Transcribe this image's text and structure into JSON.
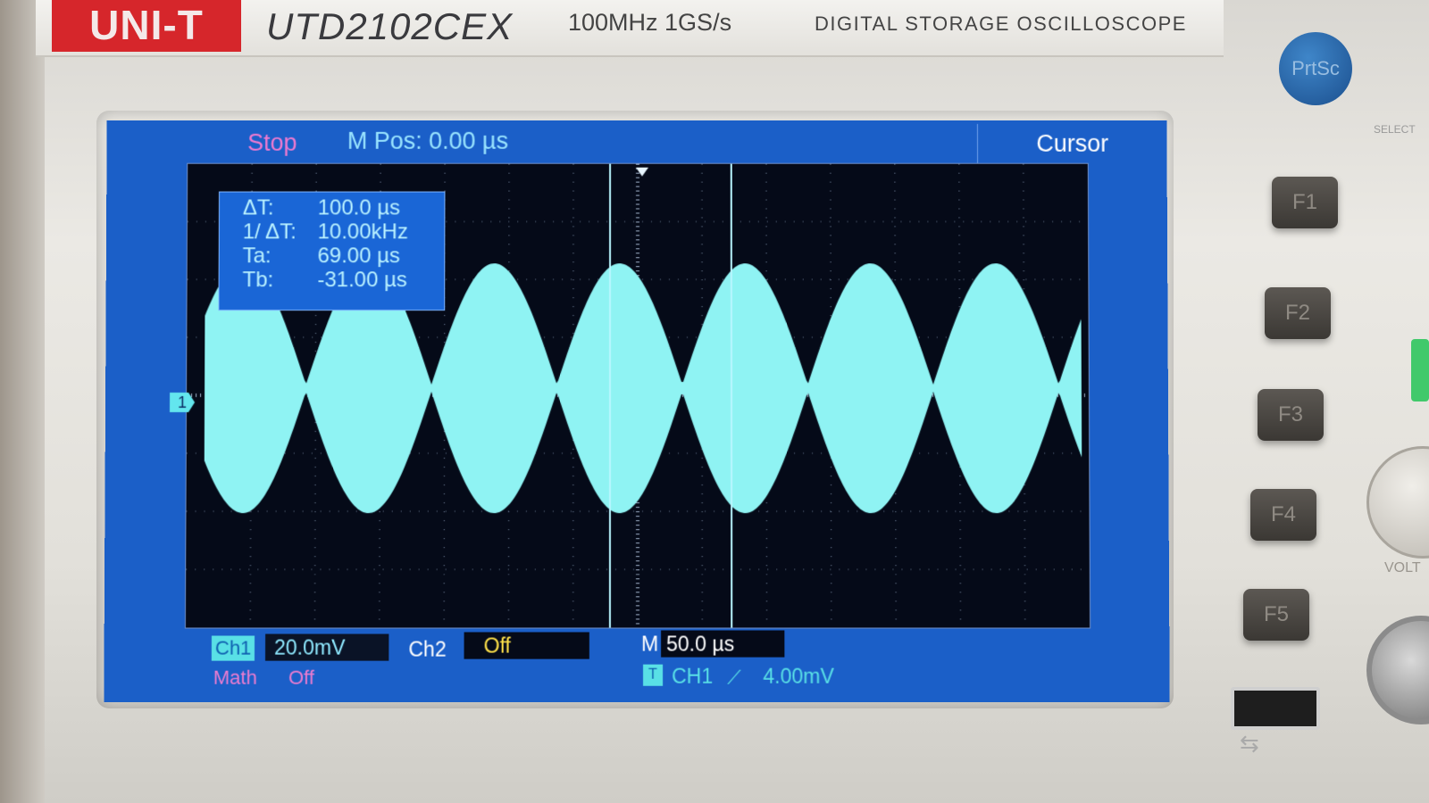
{
  "device": {
    "brand": "UNI-T",
    "model": "UTD2102CEX",
    "spec": "100MHz  1GS/s",
    "description": "DIGITAL STORAGE OSCILLOSCOPE"
  },
  "screen": {
    "run_state": "Stop",
    "m_pos": "M Pos: 0.00 µs",
    "menu_title": "Cursor",
    "cursor_readout": {
      "dt_label": "ΔT:",
      "dt_value": "100.0 µs",
      "inv_dt_label": "1/ ΔT:",
      "inv_dt_value": "10.00kHz",
      "ta_label": "Ta:",
      "ta_value": "69.00 µs",
      "tb_label": "Tb:",
      "tb_value": "-31.00 µs"
    },
    "channel_marker": "1",
    "bottom": {
      "ch1_tag": "Ch1",
      "ch1_scale": "20.0mV",
      "ch2_tag": "Ch2",
      "ch2_scale": "Off",
      "m_tag": "M",
      "m_scale": "50.0 µs",
      "math_label": "Math",
      "math_state": "Off",
      "trig_icon": "T",
      "trig_source": "CH1",
      "trig_slope_icon": "rising-edge",
      "trig_level": "4.00mV"
    }
  },
  "panel": {
    "prtsc": "PrtSc",
    "select": "SELECT",
    "volt": "VOLT",
    "fkeys": [
      "F1",
      "F2",
      "F3",
      "F4",
      "F5"
    ]
  },
  "colors": {
    "screen_bg": "#1b5fc8",
    "trace": "#8ff3f3",
    "status_pink": "#f07ad0",
    "accent_cyan": "#59e0e6",
    "yellow": "#ffe24a"
  }
}
